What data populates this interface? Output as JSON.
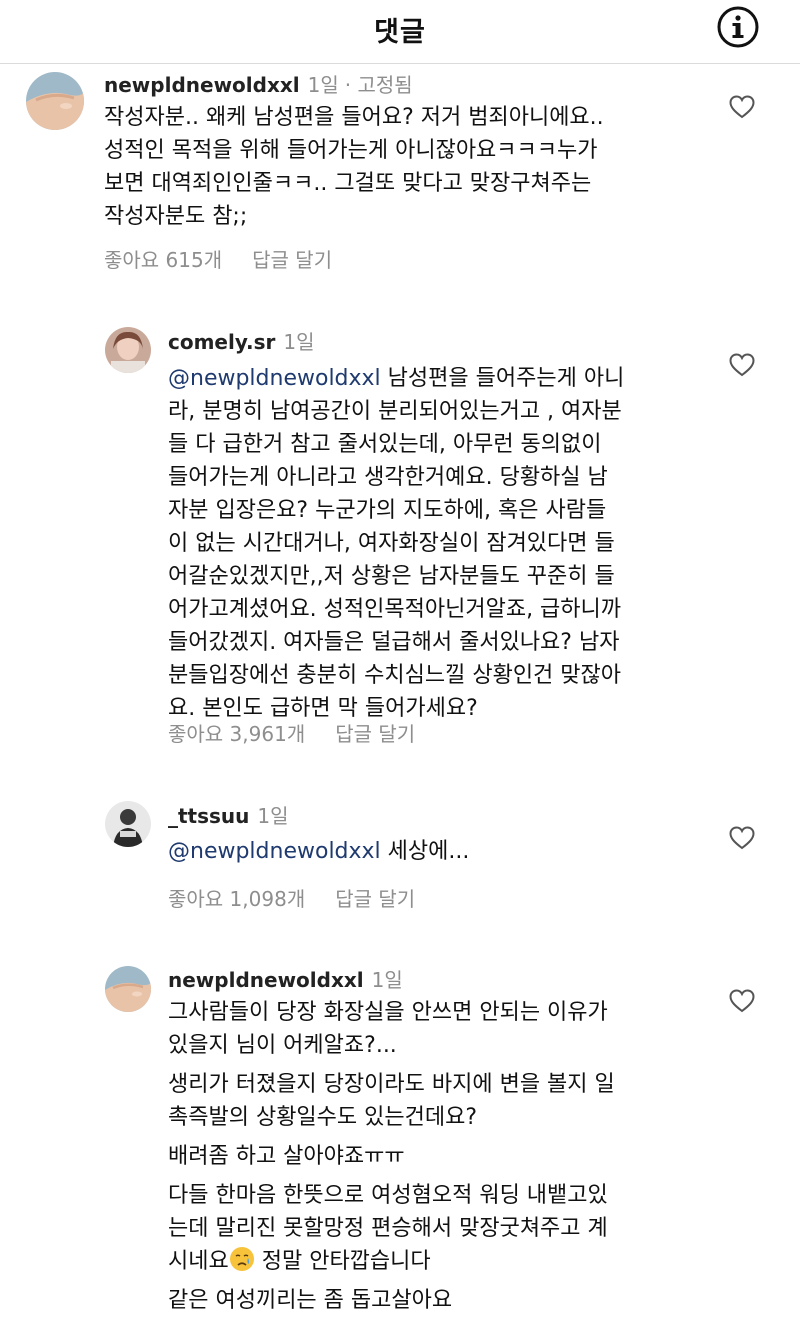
{
  "header": {
    "title": "댓글",
    "info_icon": "info-circle-icon"
  },
  "comments": [
    {
      "username": "newpldnewoldxxl",
      "time": "1일",
      "pinned": "· 고정됨",
      "mention": "",
      "paragraphs": [
        "작성자분.. 왜케 남성편을 들어요? 저거 범죄아니에요..\n성적인 목적을 위해 들어가는게 아니잖아요ㅋㅋㅋ누가\n보면 대역죄인인줄ㅋㅋ.. 그걸또 맞다고 맞장구쳐주는\n작성자분도 참;;"
      ],
      "likes": "좋아요 615개",
      "reply": "답글 달기",
      "avatar_icon": "hand-avatar"
    },
    {
      "username": "comely.sr",
      "time": "1일",
      "mention": "@newpldnewoldxxl",
      "paragraphs": [
        " 남성편을 들어주는게 아니\n라, 분명히 남여공간이 분리되어있는거고 , 여자분\n들 다 급한거 참고 줄서있는데, 아무런 동의없이\n들어가는게 아니라고 생각한거예요. 당황하실 남\n자분 입장은요?  누군가의 지도하에, 혹은 사람들\n이 없는 시간대거나, 여자화장실이 잠겨있다면 들\n어갈순있겠지만,,저 상황은 남자분들도 꾸준히 들\n어가고계셨어요. 성적인목적아닌거알죠, 급하니까\n들어갔겠지. 여자들은 덜급해서 줄서있나요? 남자\n분들입장에선 충분히 수치심느낄 상황인건 맞잖아\n요. 본인도 급하면 막 들어가세요?"
      ],
      "likes": "좋아요 3,961개",
      "reply": "답글 달기",
      "avatar_icon": "profile-photo-avatar"
    },
    {
      "username": "_ttssuu",
      "time": "1일",
      "mention": "@newpldnewoldxxl",
      "paragraphs": [
        " 세상에..."
      ],
      "likes": "좋아요 1,098개",
      "reply": "답글 달기",
      "avatar_icon": "person-photo-avatar"
    },
    {
      "username": "newpldnewoldxxl",
      "time": "1일",
      "mention": "",
      "paragraphs": [
        "그사람들이 당장 화장실을 안쓰면 안되는 이유가\n있을지 님이 어케알죠?...",
        "생리가 터졌을지 당장이라도 바지에 변을 볼지 일\n촉즉발의 상황일수도 있는건데요?",
        "배려좀 하고 살아야죠ㅠㅠ",
        "다들 한마음 한뜻으로 여성혐오적 워딩 내뱉고있\n는데 말리진 못할망정 편승해서 맞장굿쳐주고 계\n시네요",
        "같은 여성끼리는 좀 돕고살아요"
      ],
      "emoji_after_para": " 정말 안타깝습니다",
      "emoji_icon": "crying-face-emoji",
      "avatar_icon": "hand-avatar"
    }
  ],
  "colors": {
    "mention": "#1f3a6e",
    "muted": "#8e8e8e",
    "divider": "#dbdbdb"
  }
}
